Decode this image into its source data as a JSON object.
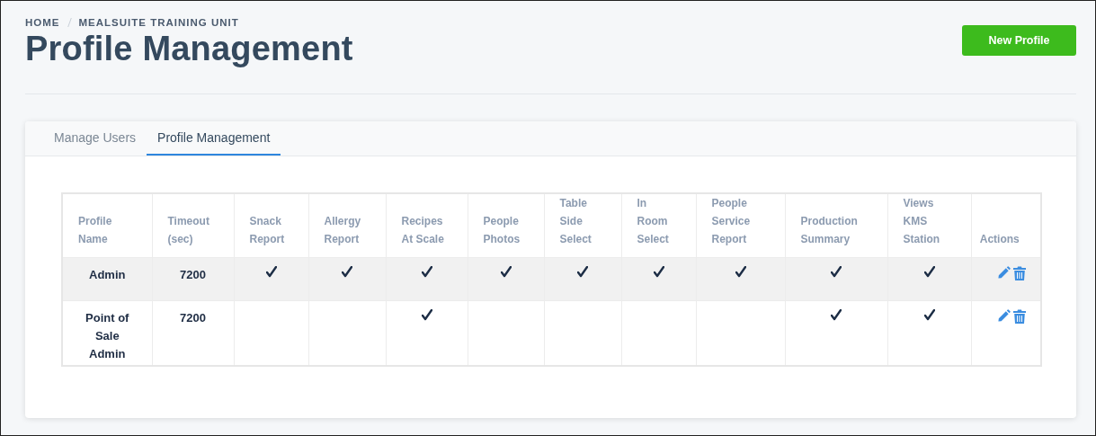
{
  "breadcrumb": [
    "HOME",
    "MEALSUITE TRAINING UNIT"
  ],
  "title": "Profile Management",
  "new_button": "New Profile",
  "tabs": [
    {
      "label": "Manage Users",
      "selected": false
    },
    {
      "label": "Profile Management",
      "selected": true
    }
  ],
  "table": {
    "columns": [
      "Profile Name",
      "Timeout (sec)",
      "Snack Report",
      "Allergy Report",
      "Recipes At Scale",
      "People Photos",
      "Table Side Select",
      "In Room Select",
      "People Service Report",
      "Production Summary",
      "Views KMS Station",
      "Actions"
    ],
    "rows": [
      {
        "name": "Admin",
        "timeout": "7200",
        "selected": true,
        "checks": [
          true,
          true,
          true,
          true,
          true,
          true,
          true,
          true,
          true
        ]
      },
      {
        "name": "Point of Sale Admin",
        "timeout": "7200",
        "selected": false,
        "checks": [
          false,
          false,
          true,
          false,
          false,
          false,
          false,
          true,
          true
        ]
      }
    ]
  }
}
